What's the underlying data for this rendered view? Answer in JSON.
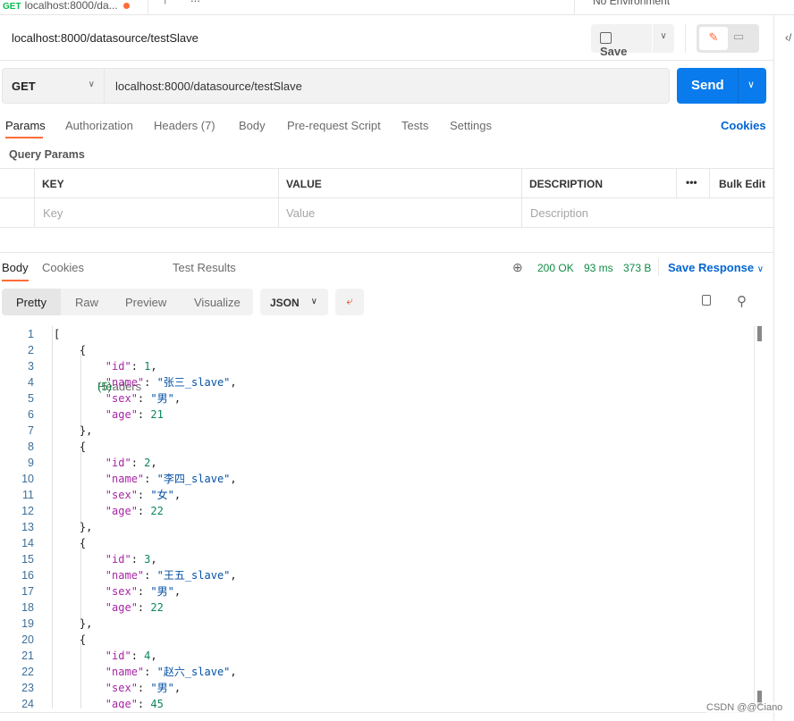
{
  "top": {
    "tab_method": "GET",
    "tab_title": "localhost:8000/da...",
    "more": "...",
    "environment": "No Environment"
  },
  "request": {
    "name": "localhost:8000/datasource/testSlave",
    "save": "Save",
    "method": "GET",
    "url": "localhost:8000/datasource/testSlave",
    "send": "Send"
  },
  "req_tabs": [
    "Params",
    "Authorization",
    "Headers (7)",
    "Body",
    "Pre-request Script",
    "Tests",
    "Settings"
  ],
  "cookies": "Cookies",
  "query_params": {
    "title": "Query Params",
    "headers": [
      "KEY",
      "VALUE",
      "DESCRIPTION"
    ],
    "bulk_edit": "Bulk Edit",
    "placeholders": [
      "Key",
      "Value",
      "Description"
    ]
  },
  "resp_tabs": {
    "body": "Body",
    "cookies": "Cookies",
    "headers": "Headers",
    "headers_count": "(5)",
    "tests": "Test Results"
  },
  "status": {
    "code": "200 OK",
    "time": "93 ms",
    "size": "373 B",
    "save_response": "Save Response",
    "color": "#0f8b45"
  },
  "view": {
    "modes": [
      "Pretty",
      "Raw",
      "Preview",
      "Visualize"
    ],
    "format": "JSON"
  },
  "code_lines": [
    [
      [
        "p",
        "["
      ]
    ],
    [
      [
        "p",
        "    {"
      ]
    ],
    [
      [
        "p",
        "        "
      ],
      [
        "k",
        "\"id\""
      ],
      [
        "p",
        ": "
      ],
      [
        "n",
        "1"
      ],
      [
        "p",
        ","
      ]
    ],
    [
      [
        "p",
        "        "
      ],
      [
        "k",
        "\"name\""
      ],
      [
        "p",
        ": "
      ],
      [
        "s",
        "\"张三_slave\""
      ],
      [
        "p",
        ","
      ]
    ],
    [
      [
        "p",
        "        "
      ],
      [
        "k",
        "\"sex\""
      ],
      [
        "p",
        ": "
      ],
      [
        "s",
        "\"男\""
      ],
      [
        "p",
        ","
      ]
    ],
    [
      [
        "p",
        "        "
      ],
      [
        "k",
        "\"age\""
      ],
      [
        "p",
        ": "
      ],
      [
        "n",
        "21"
      ]
    ],
    [
      [
        "p",
        "    },"
      ]
    ],
    [
      [
        "p",
        "    {"
      ]
    ],
    [
      [
        "p",
        "        "
      ],
      [
        "k",
        "\"id\""
      ],
      [
        "p",
        ": "
      ],
      [
        "n",
        "2"
      ],
      [
        "p",
        ","
      ]
    ],
    [
      [
        "p",
        "        "
      ],
      [
        "k",
        "\"name\""
      ],
      [
        "p",
        ": "
      ],
      [
        "s",
        "\"李四_slave\""
      ],
      [
        "p",
        ","
      ]
    ],
    [
      [
        "p",
        "        "
      ],
      [
        "k",
        "\"sex\""
      ],
      [
        "p",
        ": "
      ],
      [
        "s",
        "\"女\""
      ],
      [
        "p",
        ","
      ]
    ],
    [
      [
        "p",
        "        "
      ],
      [
        "k",
        "\"age\""
      ],
      [
        "p",
        ": "
      ],
      [
        "n",
        "22"
      ]
    ],
    [
      [
        "p",
        "    },"
      ]
    ],
    [
      [
        "p",
        "    {"
      ]
    ],
    [
      [
        "p",
        "        "
      ],
      [
        "k",
        "\"id\""
      ],
      [
        "p",
        ": "
      ],
      [
        "n",
        "3"
      ],
      [
        "p",
        ","
      ]
    ],
    [
      [
        "p",
        "        "
      ],
      [
        "k",
        "\"name\""
      ],
      [
        "p",
        ": "
      ],
      [
        "s",
        "\"王五_slave\""
      ],
      [
        "p",
        ","
      ]
    ],
    [
      [
        "p",
        "        "
      ],
      [
        "k",
        "\"sex\""
      ],
      [
        "p",
        ": "
      ],
      [
        "s",
        "\"男\""
      ],
      [
        "p",
        ","
      ]
    ],
    [
      [
        "p",
        "        "
      ],
      [
        "k",
        "\"age\""
      ],
      [
        "p",
        ": "
      ],
      [
        "n",
        "22"
      ]
    ],
    [
      [
        "p",
        "    },"
      ]
    ],
    [
      [
        "p",
        "    {"
      ]
    ],
    [
      [
        "p",
        "        "
      ],
      [
        "k",
        "\"id\""
      ],
      [
        "p",
        ": "
      ],
      [
        "n",
        "4"
      ],
      [
        "p",
        ","
      ]
    ],
    [
      [
        "p",
        "        "
      ],
      [
        "k",
        "\"name\""
      ],
      [
        "p",
        ": "
      ],
      [
        "s",
        "\"赵六_slave\""
      ],
      [
        "p",
        ","
      ]
    ],
    [
      [
        "p",
        "        "
      ],
      [
        "k",
        "\"sex\""
      ],
      [
        "p",
        ": "
      ],
      [
        "s",
        "\"男\""
      ],
      [
        "p",
        ","
      ]
    ],
    [
      [
        "p",
        "        "
      ],
      [
        "k",
        "\"age\""
      ],
      [
        "p",
        ": "
      ],
      [
        "n",
        "45"
      ]
    ]
  ],
  "watermark": "CSDN @@Ciano",
  "colors": {
    "accent": "#ff6c37",
    "send": "#097bed",
    "link": "#0265d2"
  }
}
